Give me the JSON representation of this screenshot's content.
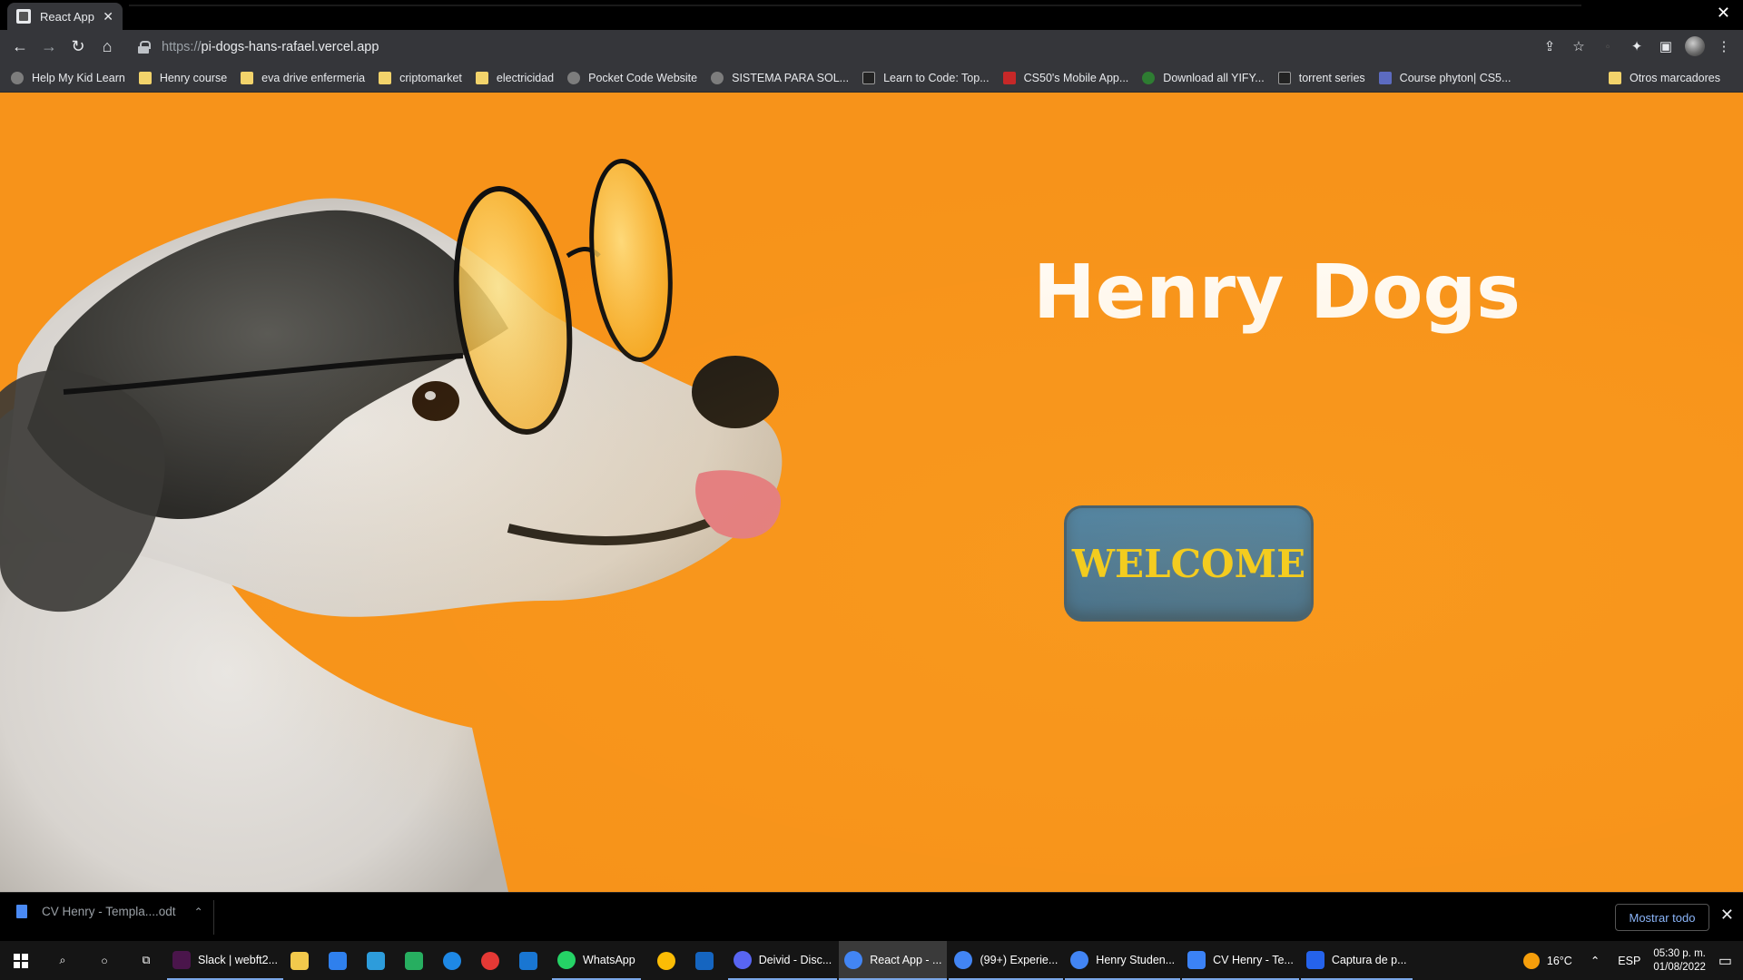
{
  "browser": {
    "tab_title": "React App",
    "url_scheme": "https://",
    "url_host": "pi-dogs-hans-rafael.vercel.app"
  },
  "bookmarks": [
    {
      "label": "Help My Kid Learn",
      "icon": "globe"
    },
    {
      "label": "Henry course",
      "icon": "folder"
    },
    {
      "label": "eva drive enfermeria",
      "icon": "folder"
    },
    {
      "label": "criptomarket",
      "icon": "folder"
    },
    {
      "label": "electricidad",
      "icon": "folder"
    },
    {
      "label": "Pocket Code Website",
      "icon": "globe"
    },
    {
      "label": "SISTEMA PARA SOL...",
      "icon": "globe"
    },
    {
      "label": "Learn to Code: Top...",
      "icon": "dark"
    },
    {
      "label": "CS50's Mobile App...",
      "icon": "red"
    },
    {
      "label": "Download all YIFY...",
      "icon": "green"
    },
    {
      "label": "torrent series",
      "icon": "dark"
    },
    {
      "label": "Course phyton| CS5...",
      "icon": "blue"
    }
  ],
  "bookmarks_other": "Otros marcadores",
  "page": {
    "title": "Henry Dogs",
    "welcome_button": "WELCOME"
  },
  "downloads": {
    "file": "CV Henry - Templa....odt",
    "show_all": "Mostrar todo"
  },
  "taskbar": {
    "apps": [
      {
        "label": "Slack | webft2...",
        "color": "#4a154b"
      },
      {
        "label": "",
        "color": "#f2c94c"
      },
      {
        "label": "",
        "color": "#2f80ed"
      },
      {
        "label": "",
        "color": "#2d9cdb"
      },
      {
        "label": "",
        "color": "#27ae60"
      },
      {
        "label": "",
        "color": "#1e88e5"
      },
      {
        "label": "",
        "color": "#e53935"
      },
      {
        "label": "",
        "color": "#1976d2"
      },
      {
        "label": "WhatsApp",
        "color": "#25d366"
      },
      {
        "label": "",
        "color": "#fbbc05"
      },
      {
        "label": "",
        "color": "#1565c0"
      },
      {
        "label": "Deivid - Disc...",
        "color": "#5865f2"
      },
      {
        "label": "React App - ...",
        "color": "#4285f4"
      },
      {
        "label": "(99+) Experie...",
        "color": "#4285f4"
      },
      {
        "label": "Henry Studen...",
        "color": "#4285f4"
      },
      {
        "label": "CV Henry - Te...",
        "color": "#3b82f6"
      },
      {
        "label": "Captura de p...",
        "color": "#2563eb"
      }
    ],
    "temperature": "16°C",
    "language": "ESP",
    "time": "05:30 p. m.",
    "date": "01/08/2022"
  }
}
